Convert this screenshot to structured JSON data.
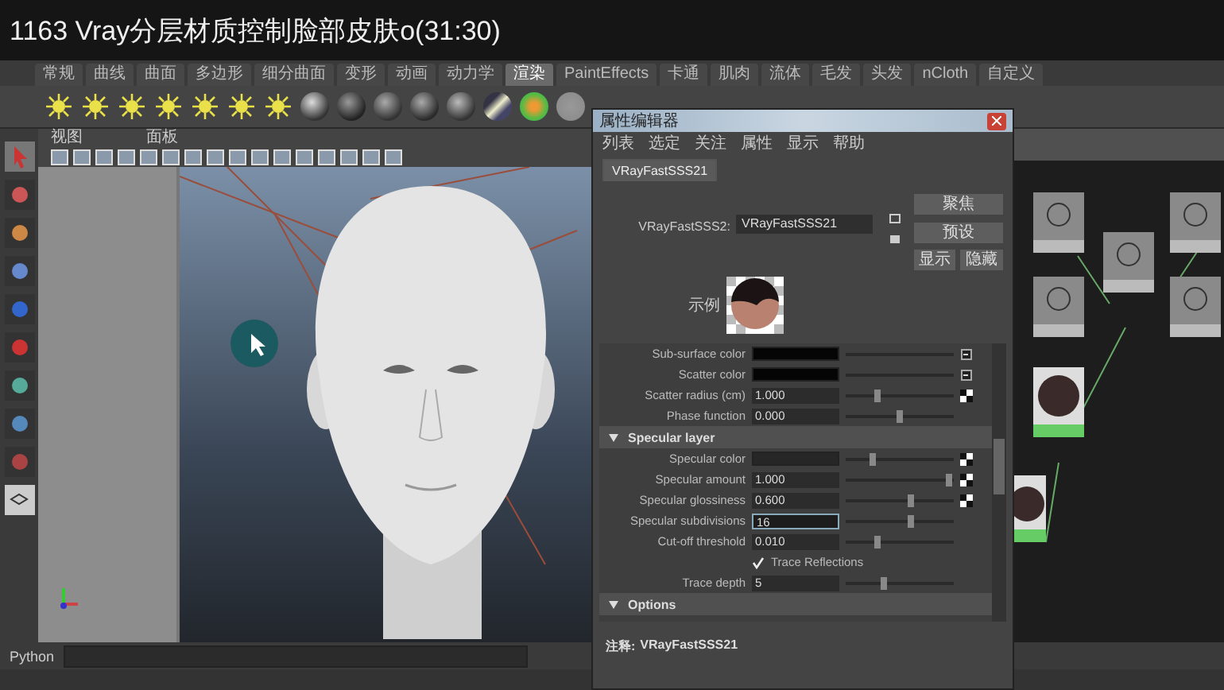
{
  "video_title": "1163 Vray分层材质控制脸部皮肤o(31:30)",
  "shelf_tabs": [
    {
      "label": "常规",
      "selected": false
    },
    {
      "label": "曲线",
      "selected": false
    },
    {
      "label": "曲面",
      "selected": false
    },
    {
      "label": "多边形",
      "selected": false
    },
    {
      "label": "细分曲面",
      "selected": false
    },
    {
      "label": "变形",
      "selected": false
    },
    {
      "label": "动画",
      "selected": false
    },
    {
      "label": "动力学",
      "selected": false
    },
    {
      "label": "渲染",
      "selected": true
    },
    {
      "label": "PaintEffects",
      "selected": false
    },
    {
      "label": "卡通",
      "selected": false
    },
    {
      "label": "肌肉",
      "selected": false
    },
    {
      "label": "流体",
      "selected": false
    },
    {
      "label": "毛发",
      "selected": false
    },
    {
      "label": "头发",
      "selected": false
    },
    {
      "label": "nCloth",
      "selected": false
    },
    {
      "label": "自定义",
      "selected": false
    }
  ],
  "viewport_menu": [
    "视图",
    "面板"
  ],
  "command_line": {
    "label": "Python"
  },
  "attribute_editor": {
    "title": "属性编辑器",
    "menu": [
      "列表",
      "选定",
      "关注",
      "属性",
      "显示",
      "帮助"
    ],
    "tabs": [
      {
        "label": "VRayFastSSS21",
        "selected": true
      }
    ],
    "node_label": "VRayFastSSS2:",
    "node_name": "VRayFastSSS21",
    "buttons": [
      "聚焦",
      "预设",
      "显示",
      "隐藏"
    ],
    "sample_label": "示例",
    "attributes": [
      {
        "kind": "color",
        "label": "Sub-surface color",
        "color": "#050505",
        "input_button": true
      },
      {
        "kind": "color",
        "label": "Scatter color",
        "color": "#050505",
        "input_button": true
      },
      {
        "kind": "number",
        "label": "Scatter radius (cm)",
        "value": "1.000",
        "level": 0.3,
        "texture_button": true
      },
      {
        "kind": "number",
        "label": "Phase function",
        "value": "0.000",
        "level": 0.5
      },
      {
        "kind": "section",
        "label": "Specular layer"
      },
      {
        "kind": "color",
        "label": "Specular color",
        "color": "#262626",
        "level": 0.25,
        "texture_button": true
      },
      {
        "kind": "number",
        "label": "Specular amount",
        "value": "1.000",
        "level": 0.95,
        "texture_button": true
      },
      {
        "kind": "number",
        "label": "Specular glossiness",
        "value": "0.600",
        "level": 0.6,
        "texture_button": true
      },
      {
        "kind": "number",
        "label": "Specular subdivisions",
        "value": "16",
        "level": 0.6,
        "focused": true
      },
      {
        "kind": "number",
        "label": "Cut-off threshold",
        "value": "0.010",
        "level": 0.3
      },
      {
        "kind": "checkbox",
        "label": "Trace Reflections",
        "checked": true
      },
      {
        "kind": "number",
        "label": "Trace depth",
        "value": "5",
        "level": 0.35
      },
      {
        "kind": "section",
        "label": "Options"
      }
    ],
    "notes": {
      "label": "注释:",
      "value": "VRayFastSSS21"
    }
  }
}
